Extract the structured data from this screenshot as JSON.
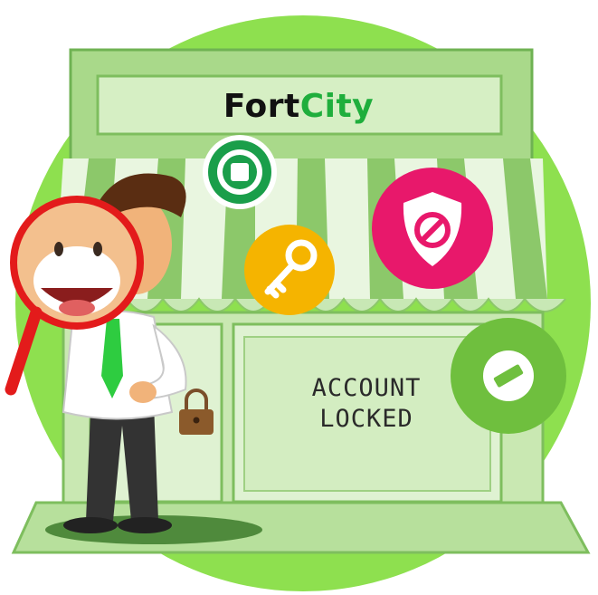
{
  "brand": {
    "part1": "Fort",
    "part2": "City",
    "part2_color": "#1fae3c"
  },
  "door_sign": {
    "line1": "ACCOUNT",
    "line2": "LOCKED"
  },
  "icons": [
    "stop-icon",
    "key-icon",
    "shield-blocked-icon",
    "minus-circle-icon",
    "padlock-icon",
    "magnifying-glass-icon"
  ],
  "colors": {
    "background_circle": "#8ee04f",
    "store": "#a9d98a",
    "awning_stripe": "#7fbf5a",
    "key_badge": "#f5b400",
    "shield_badge": "#e8186b",
    "stop_badge": "#1a9e4a",
    "minus_badge": "#6fbf3e",
    "magnifier": "#e31b1b",
    "tie": "#2ecc40"
  }
}
